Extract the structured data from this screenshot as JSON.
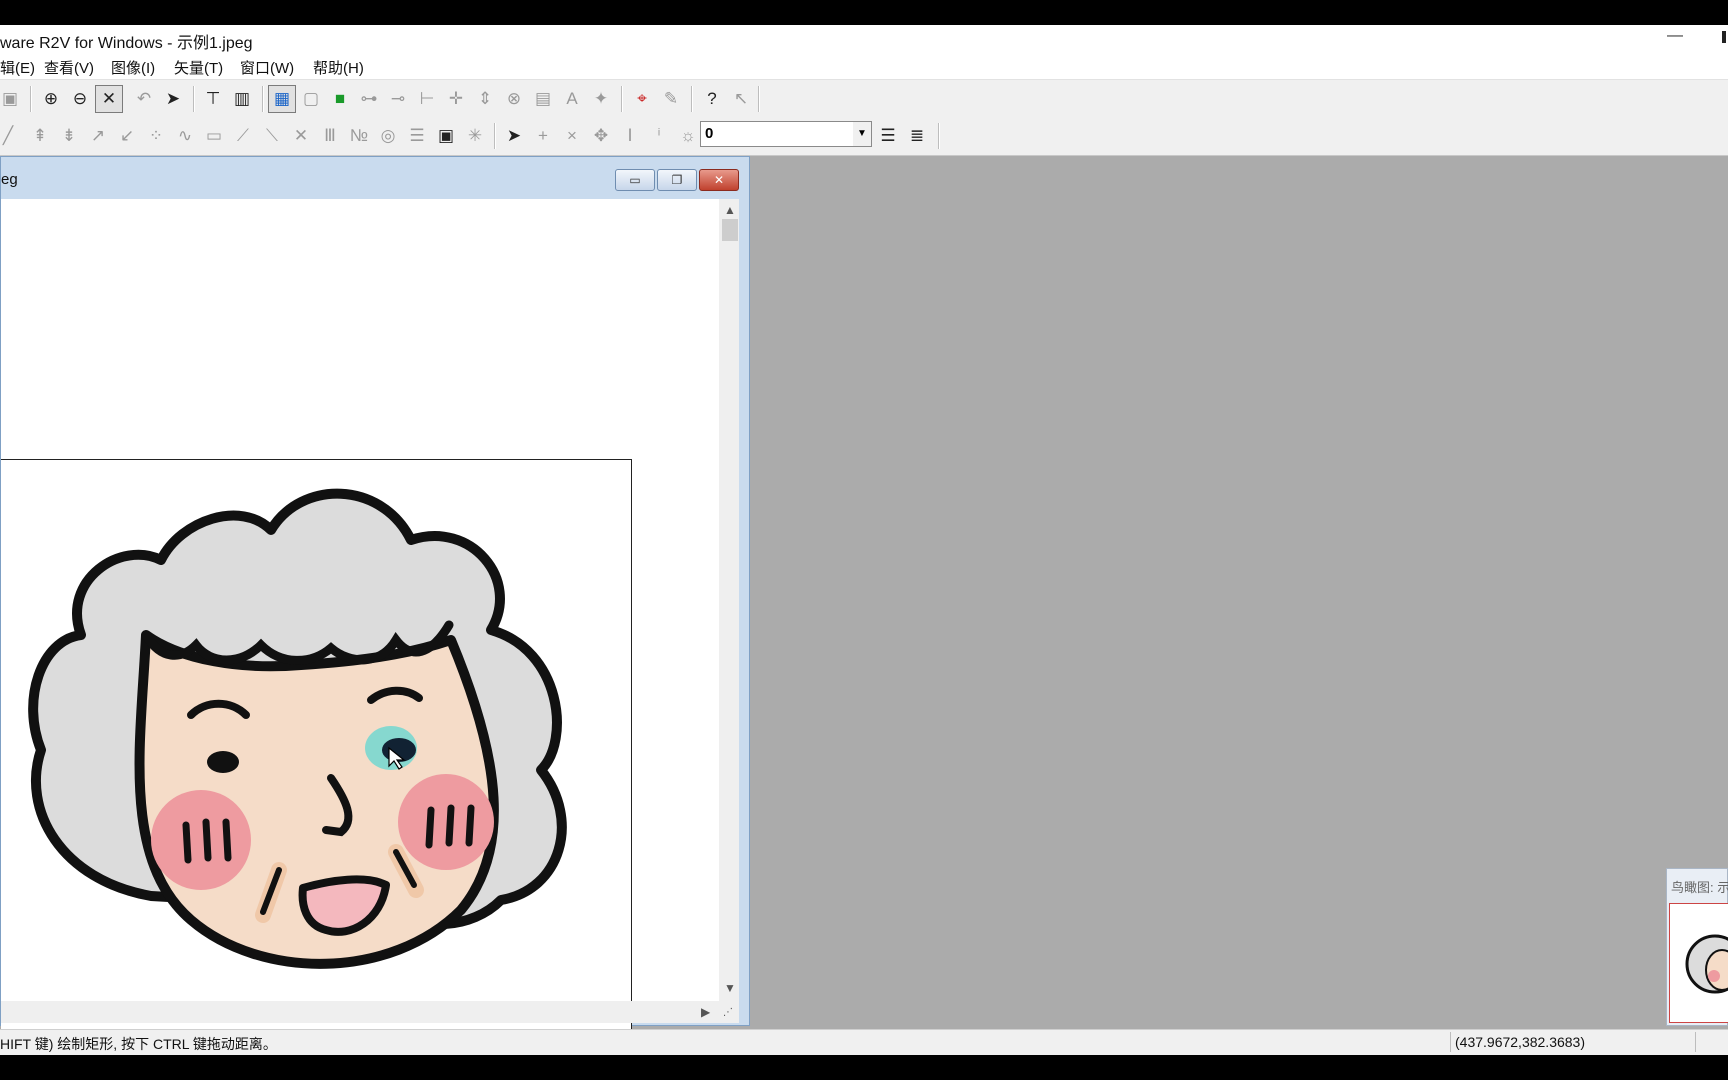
{
  "window": {
    "title": "ware R2V for Windows - 示例1.jpeg",
    "minimize_symbol": "—"
  },
  "menu": [
    {
      "label": "辑(E)"
    },
    {
      "label": "查看(V)"
    },
    {
      "label": "图像(I)"
    },
    {
      "label": "矢量(T)"
    },
    {
      "label": "窗口(W)"
    },
    {
      "label": "帮助(H)"
    }
  ],
  "layer_combo": {
    "value": "0",
    "arrow": "▼"
  },
  "child_window": {
    "title": "eg",
    "minimize": "▭",
    "restore": "❐",
    "close": "✕"
  },
  "overview": {
    "title": "鸟瞰图: 示"
  },
  "status": {
    "hint": "HIFT 键) 绘制矩形, 按下 CTRL 键拖动距离。",
    "coords": "(437.9672,382.3683)"
  },
  "icons": {
    "toolbar1": [
      "save-icon",
      "zoom-in-icon",
      "zoom-out-icon",
      "fit-icon",
      "undo-icon",
      "select-arrow-icon",
      "raster-edit-icon",
      "raster-fill-icon",
      "image-color-icon",
      "image-frame-icon",
      "green-rect-icon",
      "node-link-icon",
      "node-edit-icon",
      "node-branch-icon",
      "node-add-icon",
      "node-move-icon",
      "node-delete-icon",
      "label-text-icon",
      "label-abc-icon",
      "point-icon",
      "red-select-icon",
      "edit-props-icon",
      "help-icon",
      "context-help-icon"
    ],
    "toolbar2": [
      "line-tool-icon",
      "vertex-up-icon",
      "vertex-down-icon",
      "arrow-tool-icon",
      "arrow-tool2-icon",
      "grid-snap-icon",
      "curve-icon",
      "polygon-icon",
      "diagonal-icon",
      "diagonal2-icon",
      "cross-icon",
      "id-icon",
      "id-number-icon",
      "contour-icon",
      "layer-table-icon",
      "fill-area-icon",
      "spark-icon",
      "pointer-icon",
      "plus-tool-icon",
      "x-tool-icon",
      "move-tool-icon",
      "id-edit-icon",
      "id-label-icon",
      "light-icon",
      "layer-stack-icon",
      "layer-props-icon"
    ]
  },
  "colors": {
    "mdi_bg": "#ababab",
    "title_gradient_top": "#dbe6f4",
    "close_red": "#c0412e",
    "highlight_cyan": "#2ad6d6"
  }
}
